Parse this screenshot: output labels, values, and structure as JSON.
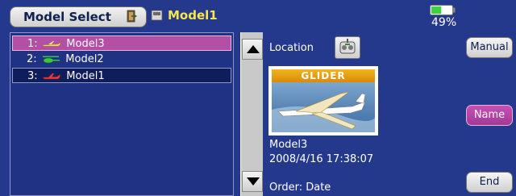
{
  "header": {
    "title_button": "Model Select",
    "current_model": "Model1",
    "battery_percent": "49%",
    "battery_level": 0.49
  },
  "list": {
    "items": [
      {
        "index": "1:",
        "name": "Model3",
        "icon": "glider-plane-icon",
        "selected": true
      },
      {
        "index": "2:",
        "name": "Model2",
        "icon": "helicopter-icon",
        "selected": false
      },
      {
        "index": "3:",
        "name": "Model1",
        "icon": "airplane-icon",
        "selected": false,
        "active": true
      }
    ]
  },
  "details": {
    "location_label": "Location",
    "picture_banner": "GLIDER",
    "model_name": "Model3",
    "date_time": "2008/4/16  17:38:07",
    "order": "Order: Date"
  },
  "buttons": {
    "manual": "Manual",
    "name": "Name",
    "end": "End"
  },
  "colors": {
    "background": "#25398c",
    "selected_row": "#b44fa6",
    "current_model_text": "#f5e64a",
    "battery": "#3fd13f"
  }
}
